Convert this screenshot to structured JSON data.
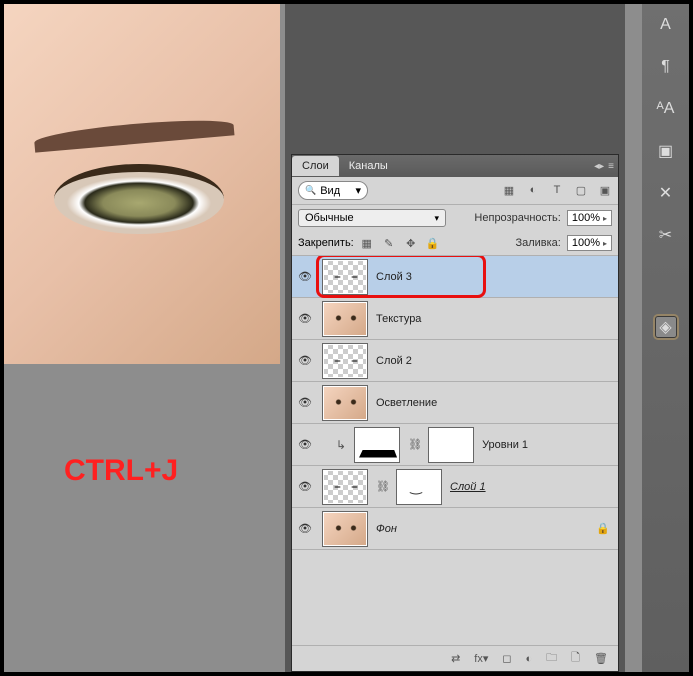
{
  "shortcut_overlay": "CTRL+J",
  "panel": {
    "tabs": {
      "layers": "Слои",
      "channels": "Каналы"
    },
    "search_placeholder": "Вид",
    "blend_mode": "Обычные",
    "opacity_label": "Непрозрачность:",
    "opacity_value": "100%",
    "lock_label": "Закрепить:",
    "fill_label": "Заливка:",
    "fill_value": "100%"
  },
  "layers": {
    "layer3": "Слой 3",
    "texture": "Текстура",
    "layer2": "Слой 2",
    "lighten": "Осветление",
    "levels1": "Уровни 1",
    "layer1": "Слой 1",
    "background": "Фон"
  },
  "rail_icons": [
    "A",
    "¶",
    "ᴬA",
    "▣",
    "✕",
    "✂",
    "◈"
  ]
}
